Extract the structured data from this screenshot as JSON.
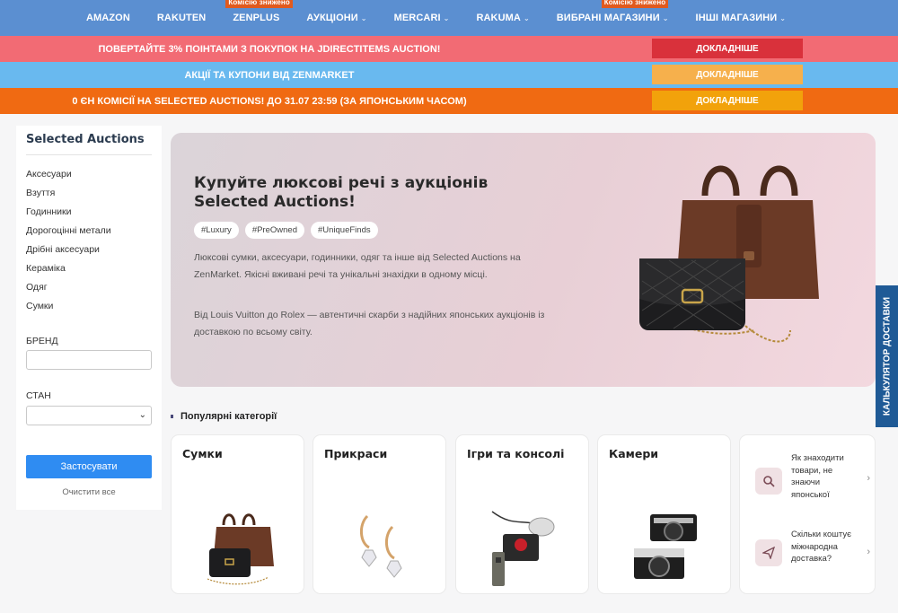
{
  "nav": {
    "items": [
      {
        "label": "AMAZON",
        "chevron": false,
        "badge": ""
      },
      {
        "label": "RAKUTEN",
        "chevron": false,
        "badge": ""
      },
      {
        "label": "ZENPLUS",
        "chevron": false,
        "badge": "Комісію знижено"
      },
      {
        "label": "АУКЦІОНИ",
        "chevron": true,
        "badge": ""
      },
      {
        "label": "MERCARI",
        "chevron": true,
        "badge": ""
      },
      {
        "label": "RAKUMA",
        "chevron": true,
        "badge": ""
      },
      {
        "label": "ВИБРАНІ МАГАЗИНИ",
        "chevron": true,
        "badge": "Комісію знижено"
      },
      {
        "label": "ІНШІ МАГАЗИНИ",
        "chevron": true,
        "badge": ""
      }
    ]
  },
  "promos": [
    {
      "text": "ПОВЕРТАЙТЕ 3% ПОІНТАМИ З ПОКУПОК НА JDIRECTITEMS AUCTION!",
      "button": "ДОКЛАДНІШЕ"
    },
    {
      "text": "АКЦІЇ ТА КУПОНИ ВІД ZENMARKET",
      "button": "ДОКЛАДНІШЕ"
    },
    {
      "text": "0 ЄН КОМІСІЇ НА SELECTED AUCTIONS! ДО 31.07 23:59 (ЗА ЯПОНСЬКИМ ЧАСОМ)",
      "button": "ДОКЛАДНІШЕ"
    }
  ],
  "sidebar": {
    "title": "Selected Auctions",
    "categories": [
      "Аксесуари",
      "Взуття",
      "Годинники",
      "Дорогоцінні метали",
      "Дрібні аксесуари",
      "Кераміка",
      "Одяг",
      "Сумки"
    ],
    "brand_label": "БРЕНД",
    "brand_value": "",
    "condition_label": "СТАН",
    "condition_value": "",
    "apply_label": "Застосувати",
    "clear_label": "Очистити все"
  },
  "hero": {
    "title": "Купуйте люксові речі з аукціонів Selected Auctions!",
    "tags": [
      "#Luxury",
      "#PreOwned",
      "#UniqueFinds"
    ],
    "paragraph1": "Люксові сумки, аксесуари, годинники, одяг та інше від Selected Auctions на ZenMarket. Якісні вживані речі та унікальні знахідки в одному місці.",
    "paragraph2": "Від Louis Vuitton до Rolex — автентичні скарби з надійних японських аукціонів із доставкою по всьому світу."
  },
  "popular": {
    "title": "Популярні категорії",
    "categories": [
      {
        "label": "Сумки",
        "icon": "bags-image"
      },
      {
        "label": "Прикраси",
        "icon": "earrings-image"
      },
      {
        "label": "Ігри та консолі",
        "icon": "game-controller-image"
      },
      {
        "label": "Камери",
        "icon": "cameras-image"
      }
    ]
  },
  "help": [
    {
      "text": "Як знаходити товари, не знаючи японської",
      "icon": "search-icon"
    },
    {
      "text": "Скільки коштує міжнародна доставка?",
      "icon": "paper-plane-icon"
    }
  ],
  "side_tab": {
    "label": "КАЛЬКУЛЯТОР ДОСТАВКИ"
  },
  "colors": {
    "nav": "#5b8fd1",
    "promo1": "#f26b74",
    "promo2": "#69b9ef",
    "promo3": "#f06a12",
    "apply": "#2f8cf2",
    "side_tab": "#1f5a96"
  }
}
